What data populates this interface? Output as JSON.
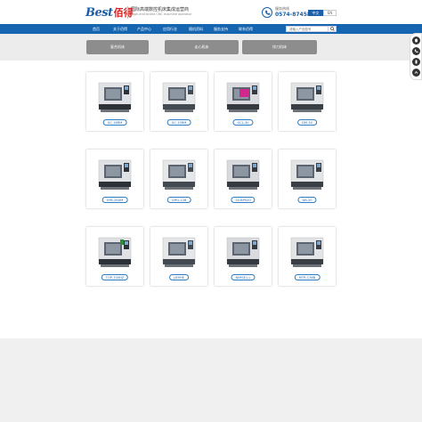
{
  "header": {
    "logo_best": "Best",
    "logo_cn": "佰得",
    "tagline_cn": "国际高端数控机床集成运营商",
    "tagline_en": "High-end brand CNC machine operator",
    "hotline_label": "服务热线",
    "hotline_number": "0574-87458709",
    "lang_cn": "中文",
    "lang_en": "EN"
  },
  "nav": {
    "items": [
      "首页",
      "关于佰得",
      "产品中心",
      "应用行业",
      "随机资料",
      "服务支持",
      "联系佰得"
    ]
  },
  "search": {
    "placeholder": "请输入产品型号"
  },
  "tabs": [
    "复合机床",
    "走心机床",
    "排刀机床"
  ],
  "products": [
    {
      "name": "GC-16RM"
    },
    {
      "name": "GC-15RM"
    },
    {
      "name": "GCL-30"
    },
    {
      "name": "DM-30"
    },
    {
      "name": "SYB-20DM"
    },
    {
      "name": "CMG-128"
    },
    {
      "name": "20-BP020"
    },
    {
      "name": "DB-20"
    },
    {
      "name": "TOP-700HZ"
    },
    {
      "name": "J-B9HE"
    },
    {
      "name": "NIMSE1-L"
    },
    {
      "name": "MTR-C36B"
    }
  ],
  "colors": {
    "brand": "#1565b0",
    "accent_red": "#d32020",
    "tab_gray": "#8d8d8d"
  },
  "side_icons": [
    "qq-icon",
    "phone-icon",
    "mobile-icon",
    "top-icon"
  ]
}
